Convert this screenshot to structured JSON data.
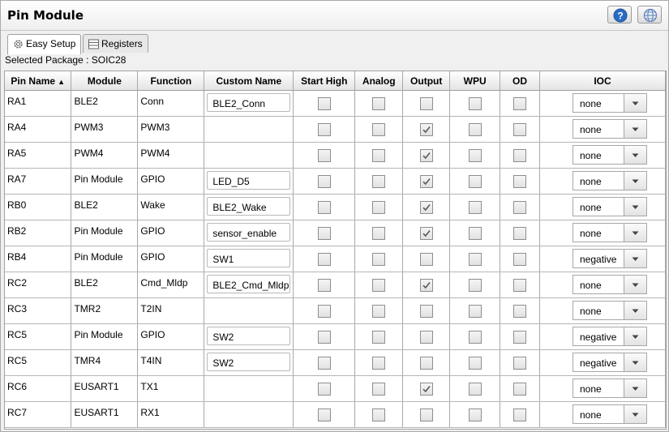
{
  "window": {
    "title": "Pin Module"
  },
  "toolbar": {
    "help_icon": "question-circle-icon",
    "globe_icon": "globe-icon"
  },
  "tabs": [
    {
      "label": "Easy Setup",
      "icon": "gear-icon",
      "active": true
    },
    {
      "label": "Registers",
      "icon": "register-list-icon",
      "active": false
    }
  ],
  "package_label": "Selected Package : SOIC28",
  "columns": {
    "pin_name": "Pin Name",
    "sort_indicator": "▲",
    "module": "Module",
    "function": "Function",
    "custom_name": "Custom Name",
    "start_high": "Start High",
    "analog": "Analog",
    "output": "Output",
    "wpu": "WPU",
    "od": "OD",
    "ioc": "IOC"
  },
  "rows": [
    {
      "pin": "RA1",
      "module": "BLE2",
      "function": "Conn",
      "custom_name": "BLE2_Conn",
      "start_high": false,
      "analog": false,
      "output": false,
      "wpu": false,
      "od": false,
      "ioc": "none"
    },
    {
      "pin": "RA4",
      "module": "PWM3",
      "function": "PWM3",
      "custom_name": "",
      "start_high": false,
      "analog": false,
      "output": true,
      "wpu": false,
      "od": false,
      "ioc": "none"
    },
    {
      "pin": "RA5",
      "module": "PWM4",
      "function": "PWM4",
      "custom_name": "",
      "start_high": false,
      "analog": false,
      "output": true,
      "wpu": false,
      "od": false,
      "ioc": "none"
    },
    {
      "pin": "RA7",
      "module": "Pin Module",
      "function": "GPIO",
      "custom_name": "LED_D5",
      "start_high": false,
      "analog": false,
      "output": true,
      "wpu": false,
      "od": false,
      "ioc": "none"
    },
    {
      "pin": "RB0",
      "module": "BLE2",
      "function": "Wake",
      "custom_name": "BLE2_Wake",
      "start_high": false,
      "analog": false,
      "output": true,
      "wpu": false,
      "od": false,
      "ioc": "none"
    },
    {
      "pin": "RB2",
      "module": "Pin Module",
      "function": "GPIO",
      "custom_name": "sensor_enable",
      "start_high": false,
      "analog": false,
      "output": true,
      "wpu": false,
      "od": false,
      "ioc": "none"
    },
    {
      "pin": "RB4",
      "module": "Pin Module",
      "function": "GPIO",
      "custom_name": "SW1",
      "start_high": false,
      "analog": false,
      "output": false,
      "wpu": false,
      "od": false,
      "ioc": "negative"
    },
    {
      "pin": "RC2",
      "module": "BLE2",
      "function": "Cmd_Mldp",
      "custom_name": "BLE2_Cmd_Mldp",
      "start_high": false,
      "analog": false,
      "output": true,
      "wpu": false,
      "od": false,
      "ioc": "none"
    },
    {
      "pin": "RC3",
      "module": "TMR2",
      "function": "T2IN",
      "custom_name": "",
      "start_high": false,
      "analog": false,
      "output": false,
      "wpu": false,
      "od": false,
      "ioc": "none"
    },
    {
      "pin": "RC5",
      "module": "Pin Module",
      "function": "GPIO",
      "custom_name": "SW2",
      "start_high": false,
      "analog": false,
      "output": false,
      "wpu": false,
      "od": false,
      "ioc": "negative"
    },
    {
      "pin": "RC5",
      "module": "TMR4",
      "function": "T4IN",
      "custom_name": "SW2",
      "start_high": false,
      "analog": false,
      "output": false,
      "wpu": false,
      "od": false,
      "ioc": "negative"
    },
    {
      "pin": "RC6",
      "module": "EUSART1",
      "function": "TX1",
      "custom_name": "",
      "start_high": false,
      "analog": false,
      "output": true,
      "wpu": false,
      "od": false,
      "ioc": "none"
    },
    {
      "pin": "RC7",
      "module": "EUSART1",
      "function": "RX1",
      "custom_name": "",
      "start_high": false,
      "analog": false,
      "output": false,
      "wpu": false,
      "od": false,
      "ioc": "none"
    }
  ],
  "colors": {
    "help_blue": "#2a6cc4",
    "check_gray": "#5a5a5a"
  }
}
